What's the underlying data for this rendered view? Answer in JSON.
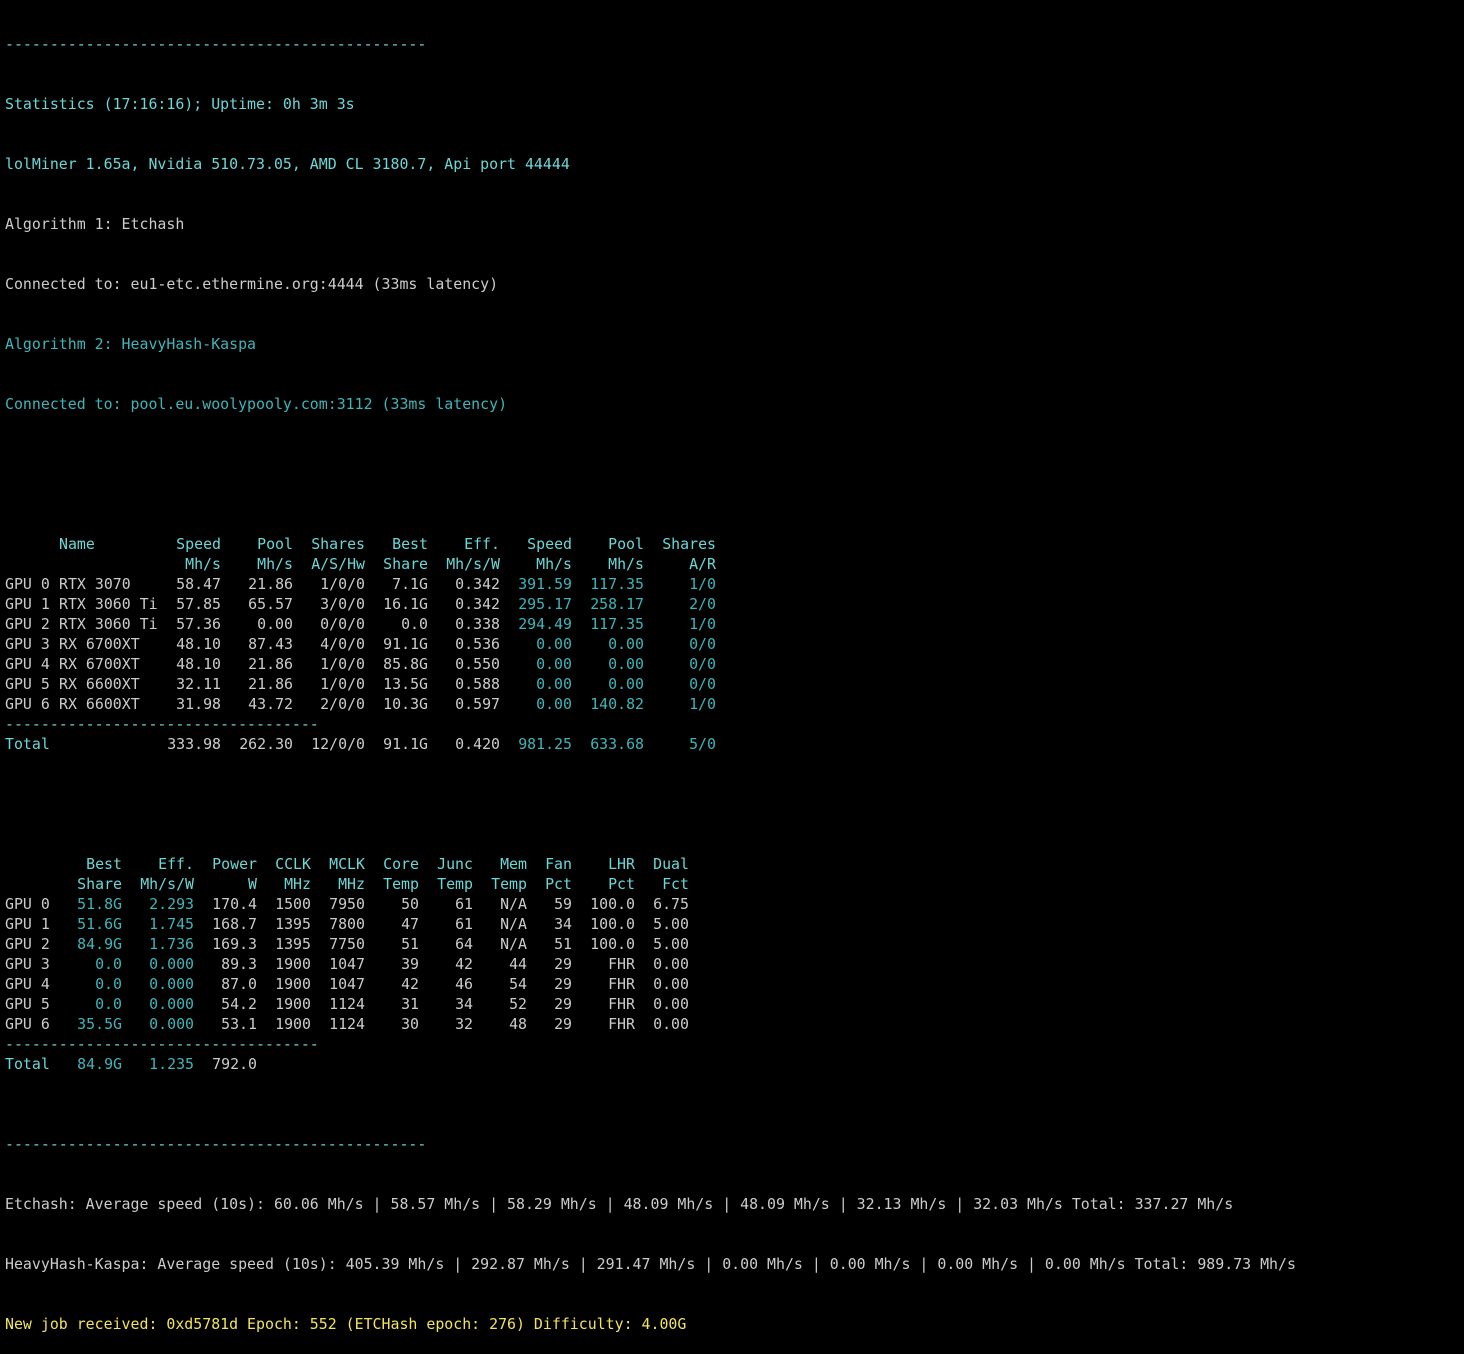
{
  "colors": {
    "background": "#000000",
    "text": "#cccccc",
    "bright_cyan": "#6bd7d7",
    "teal": "#3fb5b9",
    "yellow": "#f2e45c"
  },
  "header": {
    "sep_top": "-----------------------------------------------",
    "stats": "Statistics (17:16:16); Uptime: 0h 3m 3s",
    "version": "lolMiner 1.65a, Nvidia 510.73.05, AMD CL 3180.7, Api port 44444",
    "algo1": "Algorithm 1: Etchash",
    "conn1": "Connected to: eu1-etc.ethermine.org:4444 (33ms latency)",
    "algo2": "Algorithm 2: HeavyHash-Kaspa",
    "conn2": "Connected to: pool.eu.woolypooly.com:3112 (33ms latency)"
  },
  "table1": {
    "head1": [
      "Name",
      "Speed",
      "Pool",
      "Shares",
      "Best",
      "Eff.",
      "Speed",
      "Pool",
      "Shares"
    ],
    "head2": [
      "",
      "Mh/s",
      "Mh/s",
      "A/S/Hw",
      "Share",
      "Mh/s/W",
      "Mh/s",
      "Mh/s",
      "A/R"
    ],
    "rows": [
      [
        "GPU 0",
        "RTX 3070",
        "58.47",
        "21.86",
        "1/0/0",
        "7.1G",
        "0.342",
        "391.59",
        "117.35",
        "1/0"
      ],
      [
        "GPU 1",
        "RTX 3060 Ti",
        "57.85",
        "65.57",
        "3/0/0",
        "16.1G",
        "0.342",
        "295.17",
        "258.17",
        "2/0"
      ],
      [
        "GPU 2",
        "RTX 3060 Ti",
        "57.36",
        "0.00",
        "0/0/0",
        "0.0",
        "0.338",
        "294.49",
        "117.35",
        "1/0"
      ],
      [
        "GPU 3",
        "RX 6700XT",
        "48.10",
        "87.43",
        "4/0/0",
        "91.1G",
        "0.536",
        "0.00",
        "0.00",
        "0/0"
      ],
      [
        "GPU 4",
        "RX 6700XT",
        "48.10",
        "21.86",
        "1/0/0",
        "85.8G",
        "0.550",
        "0.00",
        "0.00",
        "0/0"
      ],
      [
        "GPU 5",
        "RX 6600XT",
        "32.11",
        "21.86",
        "1/0/0",
        "13.5G",
        "0.588",
        "0.00",
        "0.00",
        "0/0"
      ],
      [
        "GPU 6",
        "RX 6600XT",
        "31.98",
        "43.72",
        "2/0/0",
        "10.3G",
        "0.597",
        "0.00",
        "140.82",
        "1/0"
      ]
    ],
    "sep": "-----------------------------------",
    "total": [
      "Total",
      "333.98",
      "262.30",
      "12/0/0",
      "91.1G",
      "0.420",
      "981.25",
      "633.68",
      "5/0"
    ]
  },
  "table2": {
    "head1": [
      "Best",
      "Eff.",
      "Power",
      "CCLK",
      "MCLK",
      "Core",
      "Junc",
      "Mem",
      "Fan",
      "LHR",
      "Dual"
    ],
    "head2": [
      "Share",
      "Mh/s/W",
      "W",
      "MHz",
      "MHz",
      "Temp",
      "Temp",
      "Temp",
      "Pct",
      "Pct",
      "Fct"
    ],
    "rows": [
      [
        "GPU 0",
        "51.8G",
        "2.293",
        "170.4",
        "1500",
        "7950",
        "50",
        "61",
        "N/A",
        "59",
        "100.0",
        "6.75"
      ],
      [
        "GPU 1",
        "51.6G",
        "1.745",
        "168.7",
        "1395",
        "7800",
        "47",
        "61",
        "N/A",
        "34",
        "100.0",
        "5.00"
      ],
      [
        "GPU 2",
        "84.9G",
        "1.736",
        "169.3",
        "1395",
        "7750",
        "51",
        "64",
        "N/A",
        "51",
        "100.0",
        "5.00"
      ],
      [
        "GPU 3",
        "0.0",
        "0.000",
        "89.3",
        "1900",
        "1047",
        "39",
        "42",
        "44",
        "29",
        "FHR",
        "0.00"
      ],
      [
        "GPU 4",
        "0.0",
        "0.000",
        "87.0",
        "1900",
        "1047",
        "42",
        "46",
        "54",
        "29",
        "FHR",
        "0.00"
      ],
      [
        "GPU 5",
        "0.0",
        "0.000",
        "54.2",
        "1900",
        "1124",
        "31",
        "34",
        "52",
        "29",
        "FHR",
        "0.00"
      ],
      [
        "GPU 6",
        "35.5G",
        "0.000",
        "53.1",
        "1900",
        "1124",
        "30",
        "32",
        "48",
        "29",
        "FHR",
        "0.00"
      ]
    ],
    "sep": "-----------------------------------",
    "total": [
      "Total",
      "84.9G",
      "1.235",
      "792.0"
    ]
  },
  "footer": {
    "sep": "-----------------------------------------------",
    "etchash": "Etchash: Average speed (10s): 60.06 Mh/s | 58.57 Mh/s | 58.29 Mh/s | 48.09 Mh/s | 48.09 Mh/s | 32.13 Mh/s | 32.03 Mh/s Total: 337.27 Mh/s",
    "heavyhash": "HeavyHash-Kaspa: Average speed (10s): 405.39 Mh/s | 292.87 Mh/s | 291.47 Mh/s | 0.00 Mh/s | 0.00 Mh/s | 0.00 Mh/s | 0.00 Mh/s Total: 989.73 Mh/s",
    "newjob": "New job received: 0xd5781d Epoch: 552 (ETCHash epoch: 276) Difficulty: 4.00G"
  }
}
